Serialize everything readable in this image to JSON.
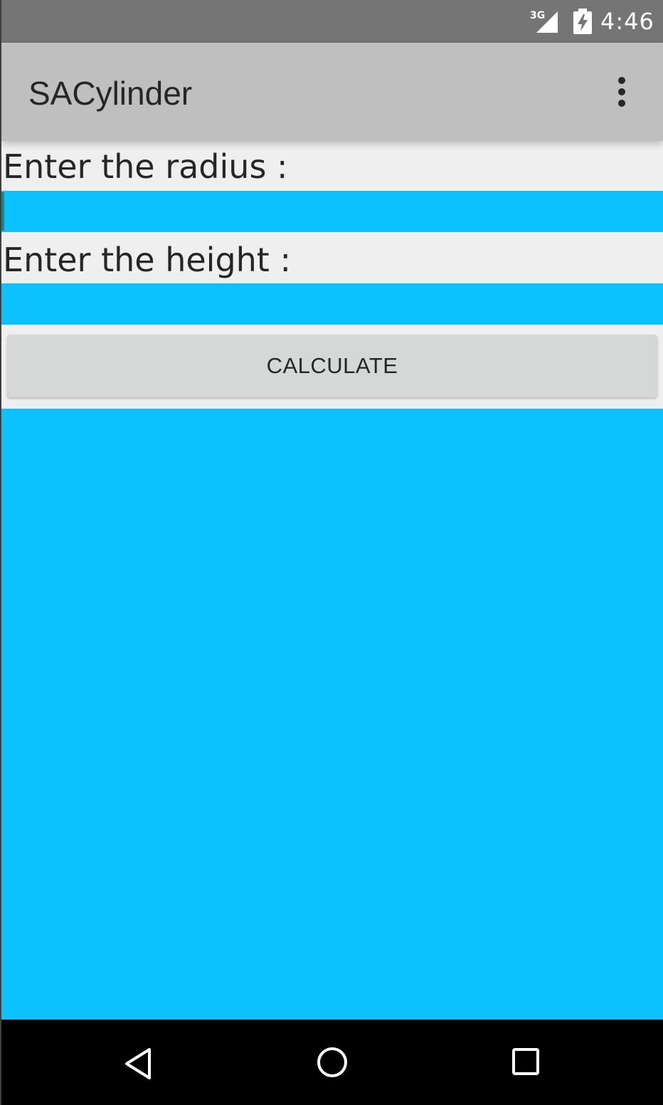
{
  "status_bar": {
    "network_label": "3G",
    "time": "4:46",
    "icons": [
      "signal-3g-icon",
      "battery-charging-icon"
    ]
  },
  "app_bar": {
    "title": "SACylinder",
    "menu_icon": "overflow-menu-icon"
  },
  "form": {
    "radius_label": "Enter the radius :",
    "radius_value": "",
    "height_label": "Enter the height :",
    "height_value": "",
    "calculate_label": "CALCULATE"
  },
  "result": {
    "text": ""
  },
  "nav_bar": {
    "icons": [
      "back-icon",
      "home-icon",
      "recents-icon"
    ]
  },
  "colors": {
    "status_bar": "#757575",
    "app_bar": "#bfbfbf",
    "field_background": "#0bc2fe",
    "button": "#d6d7d7",
    "nav_bar": "#000000"
  }
}
